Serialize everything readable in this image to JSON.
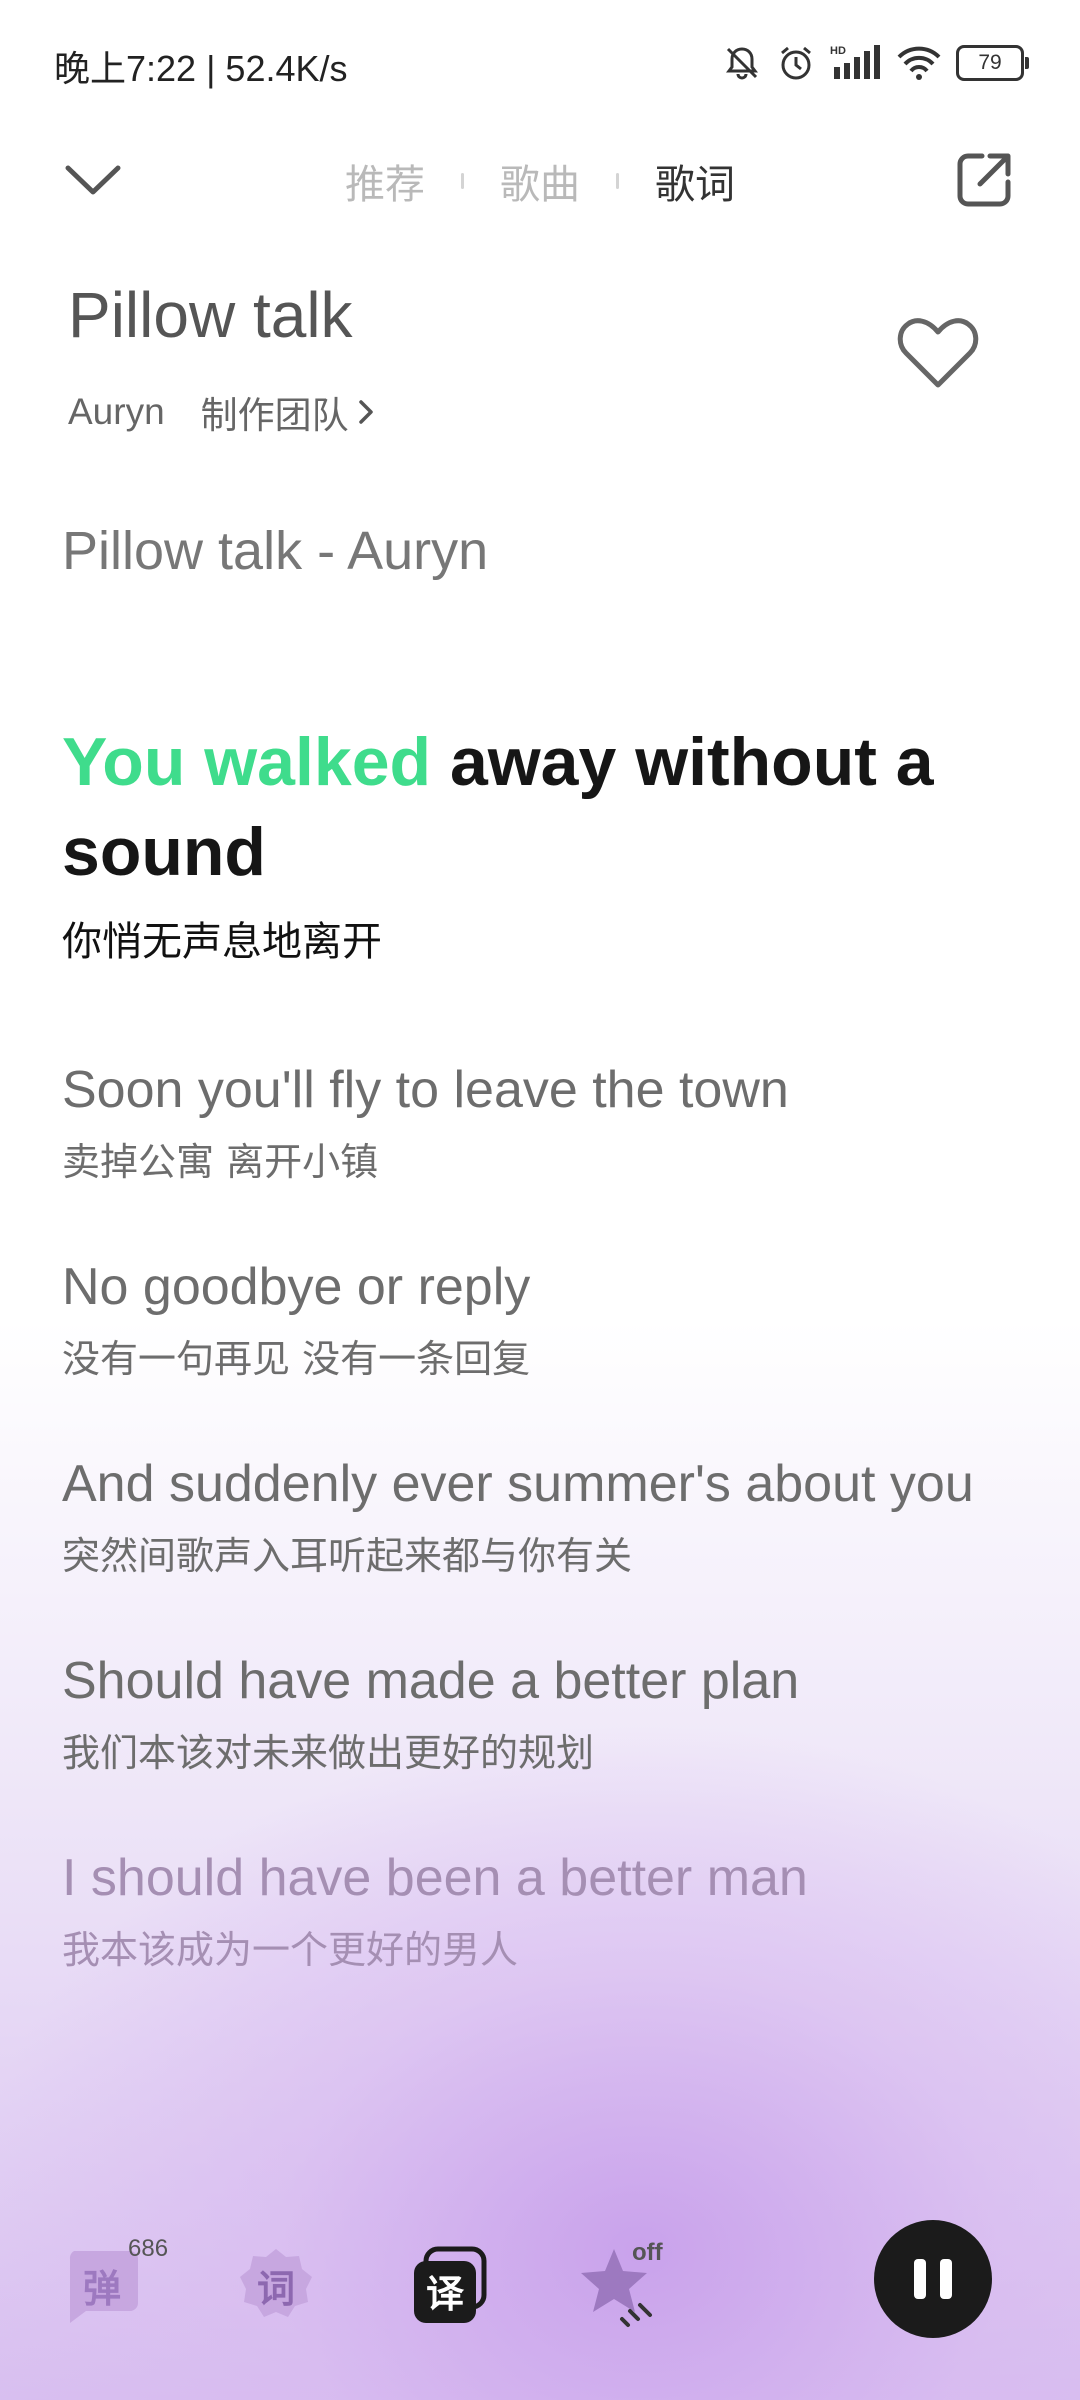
{
  "status": {
    "time_speed": "晚上7:22 | 52.4K/s",
    "battery": "79"
  },
  "tabs": [
    {
      "label": "推荐"
    },
    {
      "label": "歌曲"
    },
    {
      "label": "歌词"
    }
  ],
  "song": {
    "title": "Pillow talk",
    "artist": "Auryn",
    "credits_label": "制作团队"
  },
  "lyrics": {
    "heading": "Pillow talk - Auryn",
    "current": {
      "sung": "You walked",
      "rest": " away without a sound",
      "translation": "你悄无声息地离开"
    },
    "lines": [
      {
        "en": "Soon you'll fly to leave the town",
        "zh": "卖掉公寓 离开小镇"
      },
      {
        "en": "No goodbye or reply",
        "zh": "没有一句再见 没有一条回复"
      },
      {
        "en": "And suddenly ever summer's about you",
        "zh": "突然间歌声入耳听起来都与你有关"
      },
      {
        "en": "Should have made a better plan",
        "zh": "我们本该对未来做出更好的规划"
      },
      {
        "en": "I should have been a better man",
        "zh": "我本该成为一个更好的男人"
      }
    ]
  },
  "toolbar": {
    "danmaku_label": "弹",
    "danmaku_count": "686",
    "lyric_label": "词",
    "translate_label": "译",
    "effect_state": "off"
  },
  "colors": {
    "sung_highlight": "#3fdc8c",
    "accent_purple": "#c7a7e0"
  }
}
